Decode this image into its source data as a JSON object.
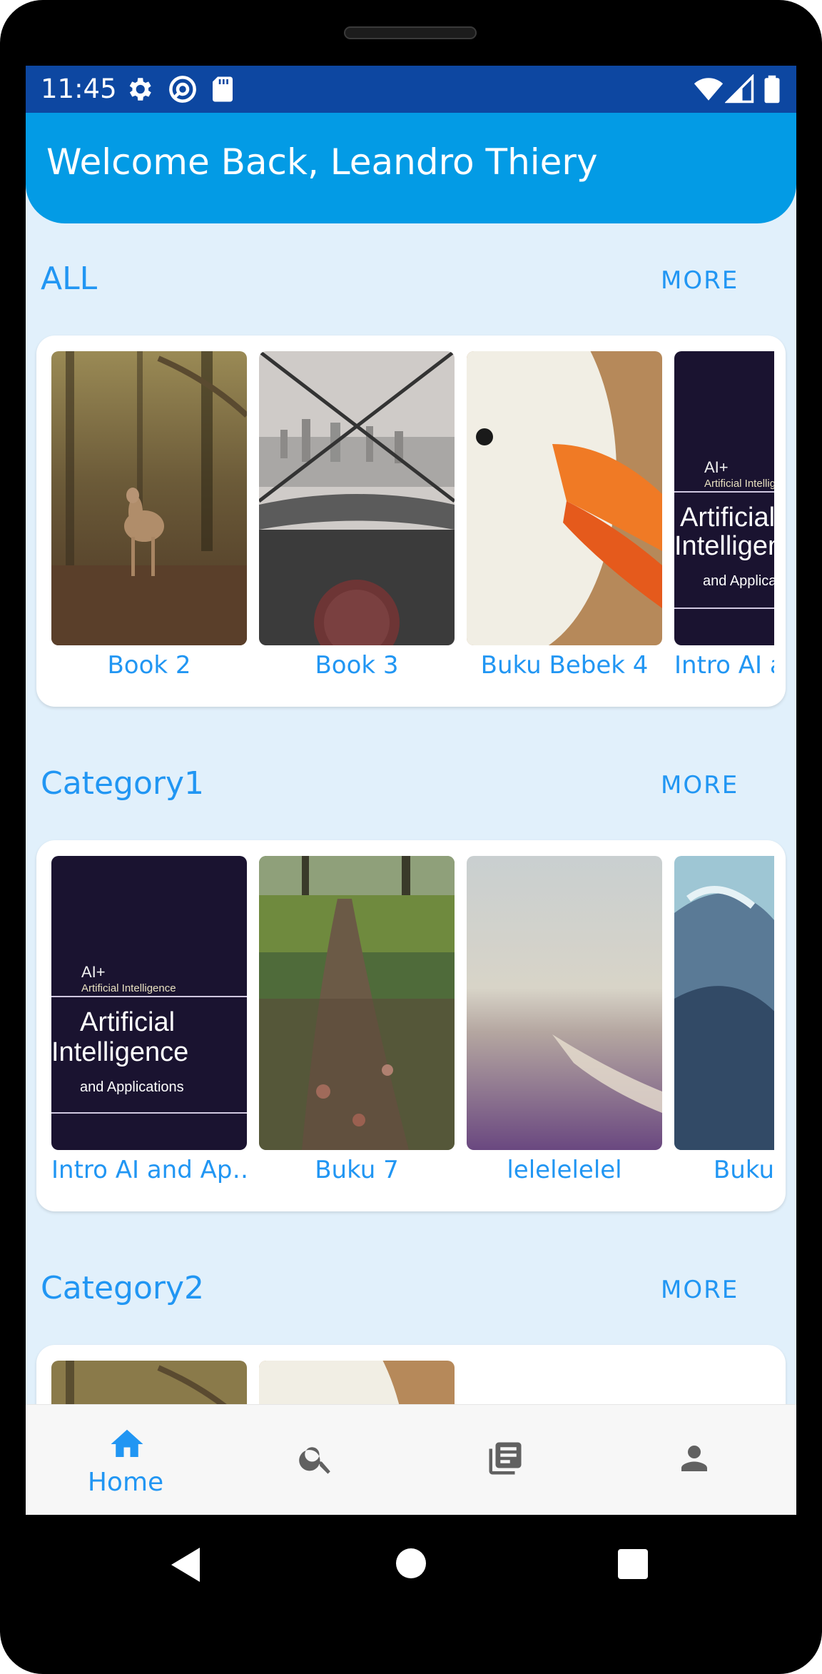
{
  "status_bar": {
    "time": "11:45",
    "left_icons": [
      "gear-icon",
      "at-sign-icon",
      "sd-card-icon"
    ],
    "right_icons": [
      "wifi-icon",
      "signal-icon",
      "battery-icon"
    ],
    "background": "#0d47a1"
  },
  "app_bar": {
    "title": "Welcome Back, Leandro Thiery",
    "background": "#039be5"
  },
  "sections": [
    {
      "title": "ALL",
      "more_label": "MORE",
      "books": [
        {
          "title": "Book 2",
          "cover": "deer-in-forest"
        },
        {
          "title": "Book 3",
          "cover": "city-through-steering-wheel"
        },
        {
          "title": "Buku Bebek 4",
          "cover": "duck-closeup"
        },
        {
          "title": "Intro AI and Applications",
          "cover": "ai-book-cover",
          "ai_line": "Artificial Intelligence",
          "ai_line_1": "Artificial",
          "ai_line_2": "Intelligence",
          "ai_sub": "and Applications",
          "ai_tag": "AI+",
          "ai_tag_2": "Artificial Intelligence"
        }
      ]
    },
    {
      "title": "Category1",
      "more_label": "MORE",
      "books": [
        {
          "title": "Intro AI and Ap…",
          "cover": "ai-book-cover",
          "ai_line_1": "Artificial",
          "ai_line_2": "Intelligence",
          "ai_sub": "and Applications",
          "ai_tag": "AI+",
          "ai_tag_2": "Artificial Intelligence"
        },
        {
          "title": "Buku 7",
          "cover": "forest-path"
        },
        {
          "title": "lelelelelel",
          "cover": "beach-shore"
        },
        {
          "title": "Buku",
          "cover": "ocean-waves"
        }
      ]
    },
    {
      "title": "Category2",
      "more_label": "MORE",
      "books": [
        {
          "cover": "deer-in-forest"
        },
        {
          "cover": "duck-closeup"
        }
      ]
    }
  ],
  "bottom_nav": [
    {
      "label": "Home",
      "icon": "home-icon",
      "active": true
    },
    {
      "label": "",
      "icon": "search-icon",
      "active": false
    },
    {
      "label": "",
      "icon": "library-icon",
      "active": false
    },
    {
      "label": "",
      "icon": "person-icon",
      "active": false
    }
  ],
  "system_nav": [
    "back-icon",
    "home-circle-icon",
    "recents-icon"
  ],
  "colors": {
    "accent": "#2196f3",
    "screen_background": "#e1f0fb",
    "inactive_icon": "#616161"
  }
}
